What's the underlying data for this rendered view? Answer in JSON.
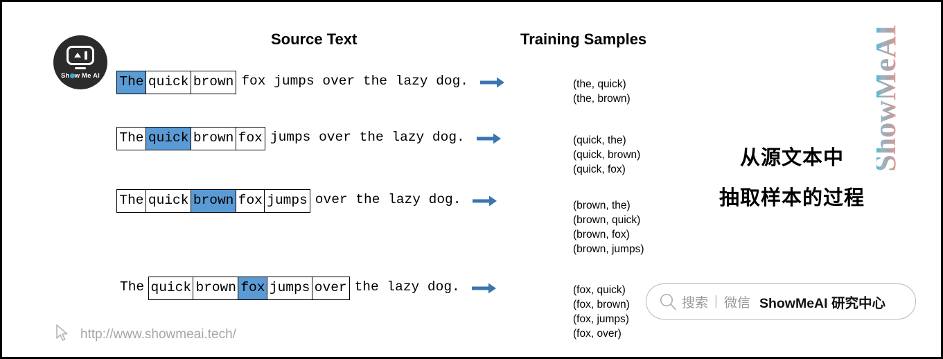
{
  "logo": {
    "brand_text": "Show Me AI",
    "accent_color": "#3aa7d8",
    "bg_color": "#2b2b2b"
  },
  "headers": {
    "source": "Source Text",
    "training": "Training Samples"
  },
  "colors": {
    "highlight": "#5b9bd5",
    "arrow": "#3a75b0",
    "border": "#000000"
  },
  "rows": [
    {
      "tokens": [
        {
          "text": "The",
          "style": "hl"
        },
        {
          "text": "quick",
          "style": "boxed"
        },
        {
          "text": "brown",
          "style": "boxed"
        }
      ],
      "tail": "fox jumps over the lazy dog."
    },
    {
      "tokens": [
        {
          "text": "The",
          "style": "boxed"
        },
        {
          "text": "quick",
          "style": "hl"
        },
        {
          "text": "brown",
          "style": "boxed"
        },
        {
          "text": "fox",
          "style": "boxed"
        }
      ],
      "tail": "jumps over the lazy dog."
    },
    {
      "tokens": [
        {
          "text": "The",
          "style": "boxed"
        },
        {
          "text": "quick",
          "style": "boxed"
        },
        {
          "text": "brown",
          "style": "hl"
        },
        {
          "text": "fox",
          "style": "boxed"
        },
        {
          "text": "jumps",
          "style": "boxed"
        }
      ],
      "tail": "over the lazy dog."
    },
    {
      "lead": "The",
      "tokens": [
        {
          "text": "quick",
          "style": "boxed"
        },
        {
          "text": "brown",
          "style": "boxed"
        },
        {
          "text": "fox",
          "style": "hl"
        },
        {
          "text": "jumps",
          "style": "boxed"
        },
        {
          "text": "over",
          "style": "boxed"
        }
      ],
      "tail": "the lazy dog."
    }
  ],
  "source_rows_text": {
    "r0_tail": "fox jumps over the lazy dog.",
    "r1_tail": "jumps over the lazy dog.",
    "r2_tail": "over the lazy dog.",
    "r3_lead": "The",
    "r3_tail": "the lazy dog."
  },
  "samples": {
    "group0": [
      "(the, quick)",
      "(the, brown)"
    ],
    "group1": [
      "(quick, the)",
      "(quick, brown)",
      "(quick, fox)"
    ],
    "group2": [
      "(brown, the)",
      "(brown, quick)",
      "(brown, fox)",
      "(brown, jumps)"
    ],
    "group3": [
      "(fox, quick)",
      "(fox, brown)",
      "(fox, jumps)",
      "(fox, over)"
    ]
  },
  "caption": {
    "line1": "从源文本中",
    "line2": "抽取样本的过程"
  },
  "search": {
    "placeholder_gray": "搜索",
    "separator": "|",
    "channel": "微信",
    "account": "ShowMeAI 研究中心"
  },
  "footer": {
    "url": "http://www.showmeai.tech/"
  },
  "wordmark": {
    "text": "ShowMeAI"
  }
}
